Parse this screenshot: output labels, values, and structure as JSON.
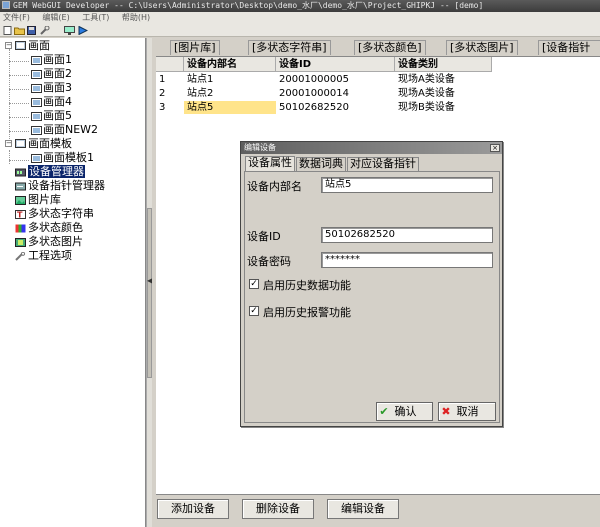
{
  "window": {
    "title": "GEM WebGUI Developer -- C:\\Users\\Administrator\\Desktop\\demo_水厂\\demo_水厂\\Project_GHIPKJ -- [demo]"
  },
  "menu": [
    "文件(F)",
    "编辑(E)",
    "工具(T)",
    "帮助(H)"
  ],
  "toolbar_icons": [
    "new-file-icon",
    "open-folder-icon",
    "save-icon",
    "wrench-icon",
    "monitor-icon",
    "run-icon"
  ],
  "tree": {
    "screens": {
      "label": "画面",
      "children": [
        "画面1",
        "画面2",
        "画面3",
        "画面4",
        "画面5",
        "画面NEW2"
      ]
    },
    "templates": {
      "label": "画面模板",
      "children": [
        "画面模板1"
      ]
    },
    "device_manager": "设备管理器",
    "pointer_manager": "设备指针管理器",
    "image_lib": "图片库",
    "multistate_string": "多状态字符串",
    "multistate_color": "多状态颜色",
    "multistate_image": "多状态图片",
    "project_options": "工程选项"
  },
  "tabs": [
    "[图片库]",
    "[多状态字符串]",
    "[多状态颜色]",
    "[多状态图片]",
    "[设备指针"
  ],
  "table": {
    "headers": [
      "设备内部名",
      "设备ID",
      "设备类别"
    ],
    "rows": [
      {
        "idx": "1",
        "name": "站点1",
        "id": "20001000005",
        "category": "现场A类设备"
      },
      {
        "idx": "2",
        "name": "站点2",
        "id": "20001000014",
        "category": "现场A类设备"
      },
      {
        "idx": "3",
        "name": "站点5",
        "id": "50102682520",
        "category": "现场B类设备"
      }
    ]
  },
  "footer_buttons": {
    "add": "添加设备",
    "delete": "删除设备",
    "edit": "编辑设备"
  },
  "dialog": {
    "title": "编辑设备",
    "tabs": [
      "设备属性",
      "数据词典",
      "对应设备指针"
    ],
    "fields": {
      "internal_name_label": "设备内部名",
      "internal_name_value": "站点5",
      "device_id_label": "设备ID",
      "device_id_value": "50102682520",
      "password_label": "设备密码",
      "password_value": "*******"
    },
    "checkboxes": {
      "history_data": "启用历史数据功能",
      "history_alarm": "启用历史报警功能"
    },
    "buttons": {
      "ok": "确认",
      "cancel": "取消"
    }
  }
}
